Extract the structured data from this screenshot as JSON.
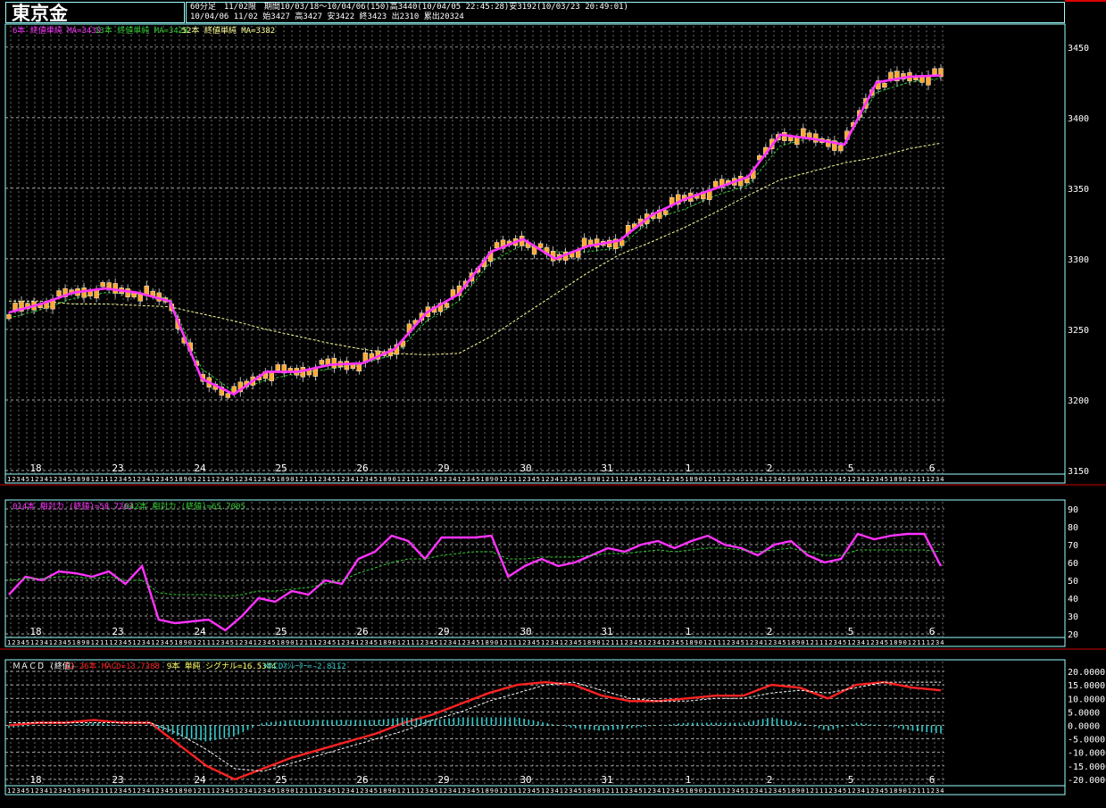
{
  "header": {
    "title": "東京金",
    "info_line1": "60分足　11/02限　期間10/03/18～10/04/06(150)高3440(10/04/05 22:45:28)安3192(10/03/23 20:49:01)",
    "info_line2": "10/04/06 11/02 始3427 高3427 安3422 終3423 出2310 累出20324"
  },
  "colors": {
    "background": "#000000",
    "grid": "#ffffff",
    "frame": "#99ffff",
    "price_ma6": "#ff33ff",
    "price_ma13": "#33cc33",
    "price_ma52": "#ffff99",
    "candle_up": "#ffaa33",
    "rsi14": "#ff33ff",
    "rsi42": "#33cc33",
    "macd": "#ff2222",
    "signal": "#ffffff",
    "osc": "#33cccc"
  },
  "price_panel": {
    "legend": [
      {
        "text": "6本 終値単純 MA=3430",
        "color": "#ff33ff"
      },
      {
        "text": "13本 終値単純 MA=3428",
        "color": "#33cc33"
      },
      {
        "text": "52本 終値単純 MA=3382",
        "color": "#ffff99"
      }
    ]
  },
  "rsi_panel": {
    "legend": [
      {
        "text": "014本 相対力 (終値)=58.7263",
        "color": "#ff33ff"
      },
      {
        "text": "042本 相対力 (終値)=65.7005",
        "color": "#33cc33"
      }
    ]
  },
  "macd_panel": {
    "legend": [
      {
        "text": "ＭＡＣＤ (終値)",
        "color": "#ffffff"
      },
      {
        "text": "12-26本 MACD=13.7388",
        "color": "#ff2222"
      },
      {
        "text": "9本 単純 シグナル=16.5344",
        "color": "#ffff66"
      },
      {
        "text": "MACDｵｼﾚｰﾀｰ=-2.8112",
        "color": "#33cccc"
      }
    ]
  },
  "chart_data": [
    {
      "type": "line",
      "title": "東京金 60分足",
      "ylim": [
        3150,
        3460
      ],
      "yticks": [
        "3450",
        "3400",
        "3350",
        "3300",
        "3250",
        "3200",
        "3150"
      ],
      "date_labels": [
        "18",
        "23",
        "24",
        "25",
        "26",
        "29",
        "30",
        "31",
        "1",
        "2",
        "5",
        "6"
      ],
      "series": [
        {
          "name": "6本 終値単純 MA",
          "values": [
            3262,
            3268,
            3276,
            3279,
            3276,
            3270,
            3215,
            3204,
            3220,
            3220,
            3225,
            3226,
            3236,
            3262,
            3275,
            3305,
            3314,
            3300,
            3309,
            3313,
            3331,
            3342,
            3350,
            3358,
            3388,
            3385,
            3381,
            3425,
            3429,
            3430
          ]
        },
        {
          "name": "13本 終値単純 MA",
          "values": [
            3258,
            3264,
            3272,
            3276,
            3275,
            3272,
            3222,
            3206,
            3214,
            3219,
            3222,
            3226,
            3232,
            3256,
            3270,
            3298,
            3310,
            3305,
            3305,
            3308,
            3328,
            3335,
            3345,
            3352,
            3380,
            3386,
            3382,
            3418,
            3425,
            3428
          ]
        },
        {
          "name": "52本 終値単純 MA",
          "values": [
            3270,
            3270,
            3268,
            3268,
            3267,
            3266,
            3261,
            3256,
            3250,
            3245,
            3240,
            3236,
            3233,
            3232,
            3233,
            3245,
            3260,
            3275,
            3290,
            3303,
            3312,
            3322,
            3333,
            3345,
            3356,
            3362,
            3368,
            3372,
            3378,
            3382
          ]
        }
      ]
    },
    {
      "type": "line",
      "title": "相対力",
      "ylim": [
        20,
        90
      ],
      "yticks": [
        "90",
        "80",
        "70",
        "60",
        "50",
        "40",
        "30",
        "20"
      ],
      "series": [
        {
          "name": "014本 相対力 (終値)",
          "values": [
            42,
            52,
            50,
            55,
            54,
            52,
            55,
            48,
            58,
            28,
            26,
            27,
            28,
            22,
            30,
            40,
            38,
            44,
            42,
            50,
            48,
            62,
            66,
            75,
            72,
            62,
            74,
            74,
            74,
            75,
            52,
            58,
            62,
            58,
            60,
            64,
            68,
            66,
            70,
            72,
            68,
            72,
            75,
            70,
            68,
            64,
            70,
            72,
            64,
            60,
            62,
            76,
            73,
            75,
            76,
            76,
            58
          ]
        },
        {
          "name": "042本 相対力 (終値)",
          "values": [
            50,
            51,
            51,
            52,
            52,
            51,
            52,
            50,
            50,
            43,
            42,
            42,
            42,
            41,
            42,
            44,
            44,
            45,
            46,
            48,
            50,
            54,
            57,
            60,
            62,
            62,
            64,
            65,
            66,
            66,
            62,
            62,
            63,
            63,
            63,
            64,
            65,
            65,
            66,
            67,
            66,
            67,
            68,
            68,
            67,
            66,
            67,
            68,
            66,
            64,
            64,
            67,
            67,
            67,
            67,
            67,
            66
          ]
        }
      ]
    },
    {
      "type": "line",
      "title": "ＭＡＣＤ (終値)",
      "ylim": [
        -21,
        21
      ],
      "yticks": [
        "20.0000",
        "15.0000",
        "10.0000",
        "5.0000",
        "0.0000",
        "-5.0000",
        "-10.0000",
        "-15.0000",
        "-20.0000"
      ],
      "series": [
        {
          "name": "12-26本 MACD",
          "values": [
            0,
            1,
            1,
            2,
            1,
            1,
            -7,
            -15,
            -20,
            -16,
            -12,
            -9,
            -6,
            -3,
            1,
            4,
            8,
            12,
            15,
            16,
            15,
            11,
            9,
            9,
            10,
            11,
            11,
            15,
            14,
            10,
            15,
            16,
            14,
            13
          ]
        },
        {
          "name": "9本 単純 シグナル",
          "values": [
            1,
            1,
            1,
            1,
            1,
            1,
            -3,
            -9,
            -16,
            -17,
            -14,
            -11,
            -8,
            -5,
            -2,
            2,
            5,
            9,
            12,
            15,
            16,
            13,
            10,
            9,
            9,
            10,
            10,
            12,
            13,
            12,
            14,
            16,
            16,
            16
          ]
        },
        {
          "name": "MACDｵｼﾚｰﾀｰ",
          "values": [
            -1,
            0,
            0,
            1,
            0,
            0,
            -4,
            -6,
            -4,
            1,
            2,
            2,
            2,
            2,
            3,
            2,
            3,
            3,
            3,
            1,
            -1,
            -2,
            -1,
            0,
            1,
            1,
            1,
            3,
            1,
            -2,
            1,
            0,
            -2,
            -3
          ]
        }
      ]
    }
  ]
}
